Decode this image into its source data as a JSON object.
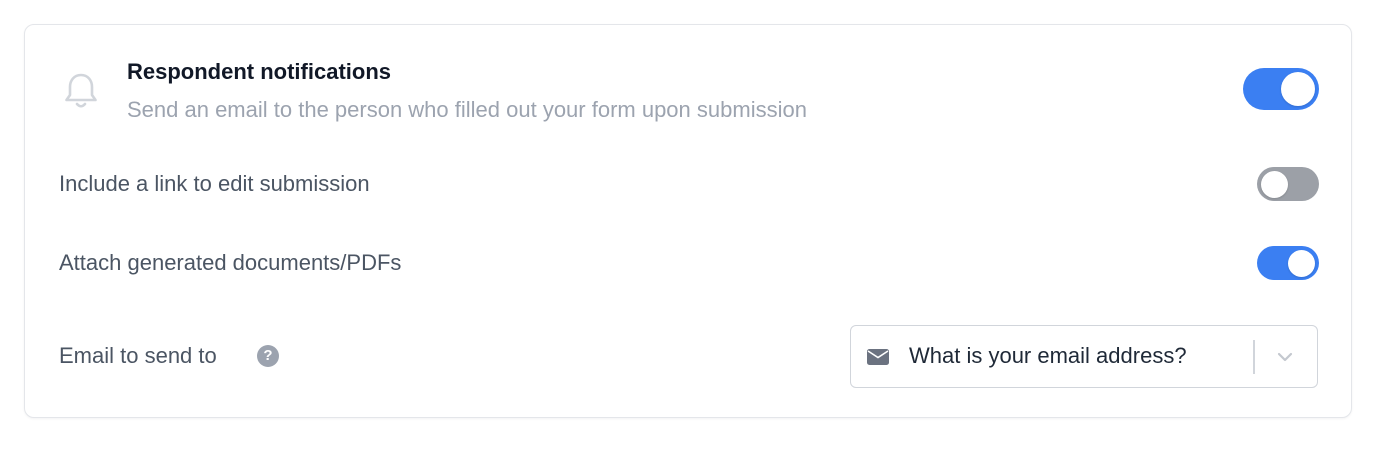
{
  "respondent_notifications": {
    "title": "Respondent notifications",
    "subtitle": "Send an email to the person who filled out your form upon submission",
    "enabled": true,
    "icon": "bell-icon"
  },
  "options": [
    {
      "label": "Include a link to edit submission",
      "enabled": false
    },
    {
      "label": "Attach generated documents/PDFs",
      "enabled": true
    }
  ],
  "email_field": {
    "label": "Email to send to",
    "help_icon": "question-circle-icon",
    "help_glyph": "?",
    "selected_value": "What is your email address?",
    "value_icon": "envelope-icon",
    "dropdown_icon": "chevron-down-icon"
  },
  "colors": {
    "accent": "#3b7ff2",
    "toggle_off": "#9ca0a7"
  }
}
